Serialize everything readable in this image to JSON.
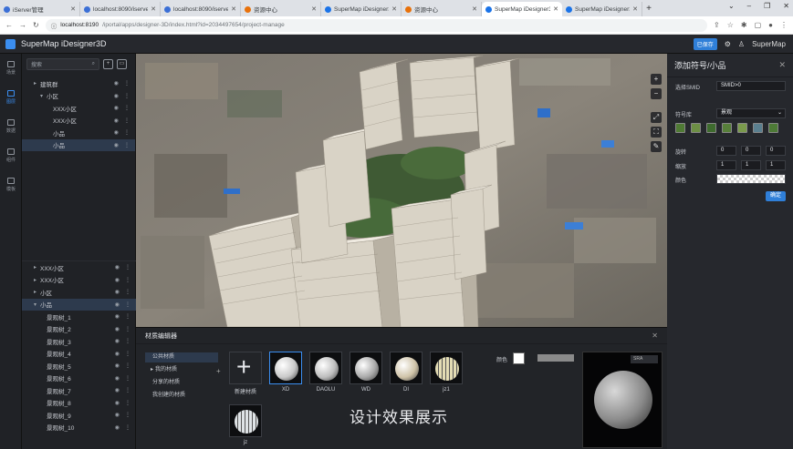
{
  "browser": {
    "tabs": [
      {
        "title": "iServer管理",
        "color": "#3b6fd6",
        "active": false
      },
      {
        "title": "localhost:8090/iserver/s",
        "color": "#3b6fd6",
        "active": false
      },
      {
        "title": "localhost:8090/iserver/s",
        "color": "#3b6fd6",
        "active": false
      },
      {
        "title": "资源中心",
        "color": "#e8710a",
        "active": false
      },
      {
        "title": "SuperMap iDesigner3D",
        "color": "#1a73e8",
        "active": false
      },
      {
        "title": "资源中心",
        "color": "#e8710a",
        "active": false
      },
      {
        "title": "SuperMap iDesigner3D",
        "color": "#1a73e8",
        "active": true
      },
      {
        "title": "SuperMap iDesigner3D",
        "color": "#1a73e8",
        "active": false
      }
    ],
    "new_tab": "+",
    "window_controls": [
      "⌄",
      "–",
      "❐",
      "✕"
    ],
    "url_host": "localhost:8190",
    "url_path": "/iportal/apps/designer-3D/index.html?id=2034497654/project-manage"
  },
  "app": {
    "title": "SuperMap iDesigner3D",
    "header_button": "已保存",
    "user": "SuperMap"
  },
  "rail": [
    {
      "label": "场景",
      "active": false
    },
    {
      "label": "图层",
      "active": true
    },
    {
      "label": "数据",
      "active": false
    },
    {
      "label": "组件",
      "active": false
    },
    {
      "label": "模板",
      "active": false
    }
  ],
  "tree": {
    "search_placeholder": "搜索",
    "top_rows": [
      {
        "label": "建筑群",
        "indent": 1,
        "arrow": "▸",
        "selected": false
      },
      {
        "label": "小区",
        "indent": 2,
        "arrow": "▾",
        "selected": false
      },
      {
        "label": "XXX小区",
        "indent": 3,
        "arrow": "",
        "selected": false
      },
      {
        "label": "XXX小区",
        "indent": 3,
        "arrow": "",
        "selected": false
      },
      {
        "label": "小品",
        "indent": 3,
        "arrow": "",
        "selected": false
      },
      {
        "label": "小品",
        "indent": 3,
        "arrow": "",
        "selected": true
      }
    ],
    "bottom_rows": [
      {
        "label": "XXX小区",
        "indent": 1,
        "arrow": "▸",
        "selected": false
      },
      {
        "label": "XXX小区",
        "indent": 1,
        "arrow": "▸",
        "selected": false
      },
      {
        "label": "小区",
        "indent": 1,
        "arrow": "▸",
        "selected": false
      },
      {
        "label": "小品",
        "indent": 1,
        "arrow": "▾",
        "selected": true
      },
      {
        "label": "景观树_1",
        "indent": 2,
        "arrow": "",
        "selected": false
      },
      {
        "label": "景观树_2",
        "indent": 2,
        "arrow": "",
        "selected": false
      },
      {
        "label": "景观树_3",
        "indent": 2,
        "arrow": "",
        "selected": false
      },
      {
        "label": "景观树_4",
        "indent": 2,
        "arrow": "",
        "selected": false
      },
      {
        "label": "景观树_5",
        "indent": 2,
        "arrow": "",
        "selected": false
      },
      {
        "label": "景观树_6",
        "indent": 2,
        "arrow": "",
        "selected": false
      },
      {
        "label": "景观树_7",
        "indent": 2,
        "arrow": "",
        "selected": false
      },
      {
        "label": "景观树_8",
        "indent": 2,
        "arrow": "",
        "selected": false
      },
      {
        "label": "景观树_9",
        "indent": 2,
        "arrow": "",
        "selected": false
      },
      {
        "label": "景观树_10",
        "indent": 2,
        "arrow": "",
        "selected": false
      }
    ]
  },
  "viewport": {
    "tools": [
      "+",
      "−",
      "⤢",
      "⛶",
      "✎"
    ]
  },
  "props": {
    "title": "添加符号/小品",
    "smid_label": "选择SMID",
    "smid_value": "SMID>0",
    "symbol_label": "符号库",
    "symbol_value": "景观",
    "rotate_label": "旋转",
    "rotate": [
      "0",
      "0",
      "0"
    ],
    "scale_label": "缩放",
    "scale": [
      "1",
      "1",
      "1"
    ],
    "color_label": "颜色",
    "apply": "确定"
  },
  "materials": {
    "title": "材质编辑器",
    "categories": [
      {
        "label": "公共材质",
        "arrow": "",
        "selected": true
      },
      {
        "label": "我的材质",
        "arrow": "▸",
        "selected": false
      },
      {
        "label": "分享的材质",
        "arrow": "",
        "selected": false
      },
      {
        "label": "我创建的材质",
        "arrow": "",
        "selected": false
      }
    ],
    "new_label": "新建材质",
    "items": [
      {
        "label": "XD",
        "color": "#c9c9c9",
        "selected": true,
        "stripes": false
      },
      {
        "label": "DAOLU",
        "color": "#bdbdbd",
        "selected": false,
        "stripes": false
      },
      {
        "label": "WD",
        "color": "#a9a9a9",
        "selected": false,
        "stripes": false
      },
      {
        "label": "DI",
        "color": "#cfc3a8",
        "selected": false,
        "stripes": false
      },
      {
        "label": "jz1",
        "color": "#e3dcb4",
        "selected": false,
        "stripes": true
      },
      {
        "label": "jz",
        "color": "#dfe3e6",
        "selected": false,
        "stripes": true
      }
    ],
    "color_label": "颜色",
    "preview_mode": "SRA",
    "caption": "设计效果展示"
  }
}
